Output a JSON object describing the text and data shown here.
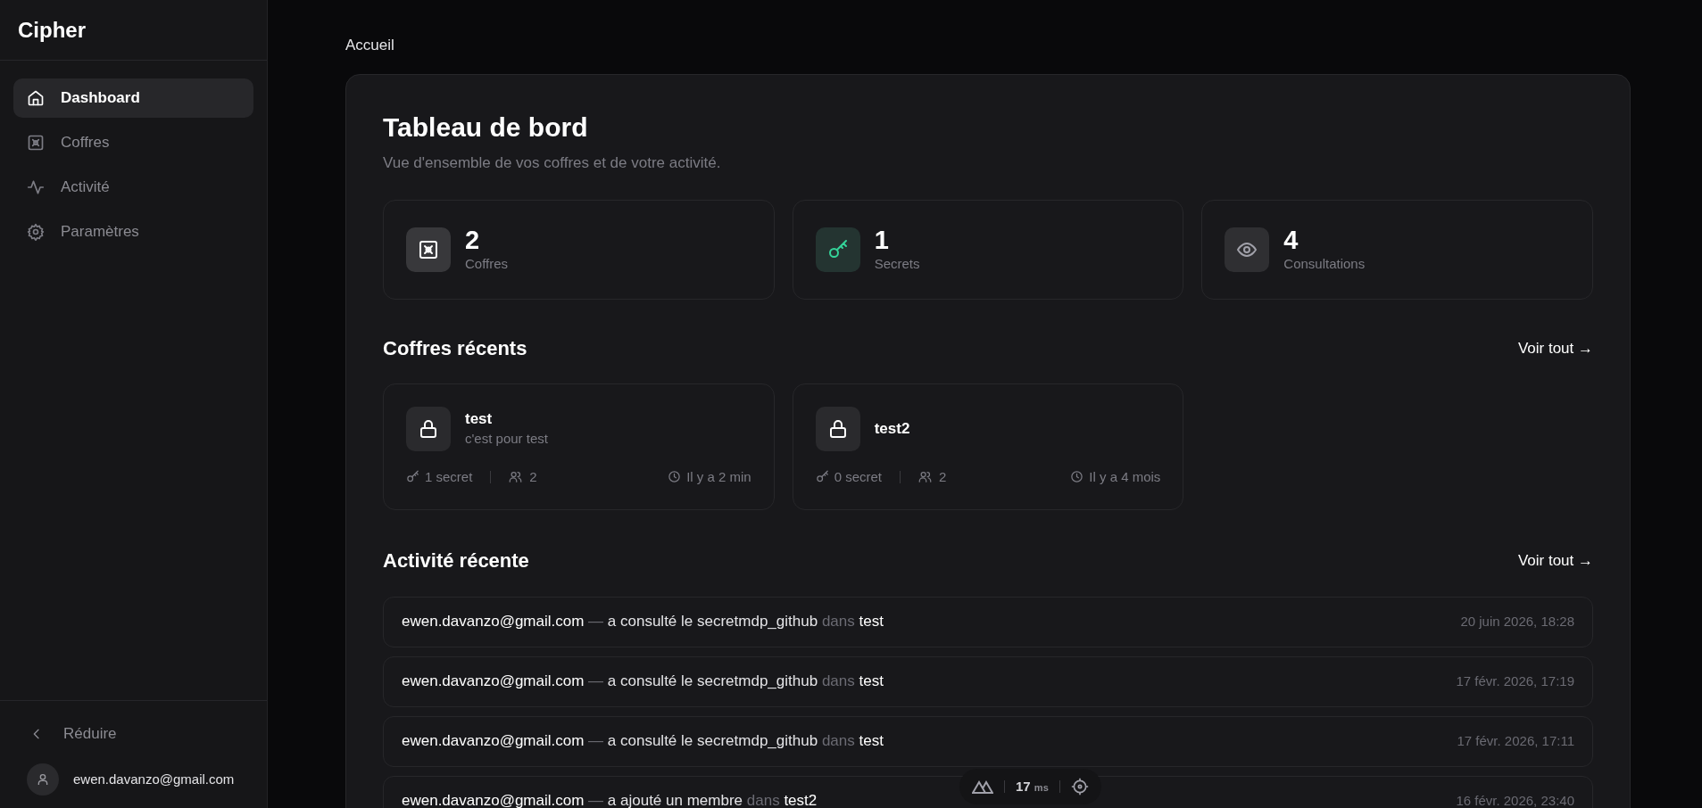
{
  "sidebar": {
    "logo": "Cipher",
    "items": [
      {
        "label": "Dashboard",
        "selected": true
      },
      {
        "label": "Coffres",
        "selected": false
      },
      {
        "label": "Activité",
        "selected": false
      },
      {
        "label": "Paramètres",
        "selected": false
      }
    ],
    "collapse": "Réduire",
    "user": "ewen.davanzo@gmail.com"
  },
  "breadcrumb": "Accueil",
  "title": "Tableau de bord",
  "subtitle": "Vue d'ensemble de vos coffres et de votre activité.",
  "stats": [
    {
      "value": "2",
      "label": "Coffres",
      "color": "#ffffff"
    },
    {
      "value": "1",
      "label": "Secrets",
      "color": "#34d399"
    },
    {
      "value": "4",
      "label": "Consultations",
      "color": "#a1a1aa"
    }
  ],
  "recent_vaults": {
    "heading": "Coffres récents",
    "link": "Voir tout →",
    "items": [
      {
        "name": "test",
        "description": "c'est pour test",
        "secrets": "1 secret",
        "members": "2",
        "updated": "Il y a 2 min"
      },
      {
        "name": "test2",
        "secrets": "0 secret",
        "members": "2",
        "updated": "Il y a 4 mois"
      }
    ]
  },
  "recent_activity": {
    "heading": "Activité récente",
    "link": "Voir tout →",
    "items": [
      {
        "user": "ewen.davanzo@gmail.com",
        "dash": "—",
        "action": "a consulté le secretmdp_github",
        "prep": "dans",
        "vault": "test",
        "time": "20 juin 2026, 18:28"
      },
      {
        "user": "ewen.davanzo@gmail.com",
        "dash": "—",
        "action": "a consulté le secretmdp_github",
        "prep": "dans",
        "vault": "test",
        "time": "17 févr. 2026, 17:19"
      },
      {
        "user": "ewen.davanzo@gmail.com",
        "dash": "—",
        "action": "a consulté le secretmdp_github",
        "prep": "dans",
        "vault": "test",
        "time": "17 févr. 2026, 17:11"
      },
      {
        "user": "ewen.davanzo@gmail.com",
        "dash": "—",
        "action": "a ajouté un membre",
        "prep": "dans",
        "vault": "test2",
        "time": "16 févr. 2026, 23:40"
      }
    ]
  },
  "devtools": {
    "time": "17",
    "unit": "ms"
  }
}
